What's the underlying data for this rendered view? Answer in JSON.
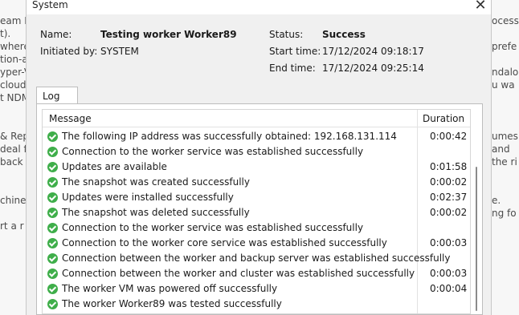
{
  "background": {
    "left_lines": [
      "eam B",
      "t).",
      "where",
      "tion-a",
      "yper-V",
      " cloud",
      "t NDM",
      "",
      "",
      "& Rep",
      "deal f",
      " back",
      "",
      "",
      "chine",
      "",
      "rt a r"
    ],
    "right_lines": [
      "ocess",
      "",
      "prefe",
      "",
      "ndalo",
      "u wa",
      "",
      "",
      "",
      "umes",
      "and",
      "the ri",
      "",
      "",
      "e.",
      "ng fo",
      ""
    ]
  },
  "dialog": {
    "title": "System",
    "close_symbol": "✕",
    "name_label": "Name:",
    "name_value": "Testing worker Worker89",
    "initiated_label": "Initiated by:",
    "initiated_value": "SYSTEM",
    "status_label": "Status:",
    "status_value": "Success",
    "start_label": "Start time:",
    "start_value": "17/12/2024 09:18:17",
    "end_label": "End time:",
    "end_value": "17/12/2024 09:25:14",
    "tab_label": "Log",
    "columns": {
      "message": "Message",
      "duration": "Duration"
    },
    "rows": [
      {
        "message": "The following IP address was successfully obtained: 192.168.131.114",
        "duration": "0:00:42"
      },
      {
        "message": "Connection to the worker service was established successfully",
        "duration": ""
      },
      {
        "message": "Updates are available",
        "duration": "0:01:58"
      },
      {
        "message": "The snapshot was created successfully",
        "duration": "0:00:02"
      },
      {
        "message": "Updates were installed successfully",
        "duration": "0:02:37"
      },
      {
        "message": "The snapshot was deleted successfully",
        "duration": "0:00:02"
      },
      {
        "message": "Connection to the worker service was established successfully",
        "duration": ""
      },
      {
        "message": "Connection to the worker core service was established successfully",
        "duration": "0:00:03"
      },
      {
        "message": "Connection between the worker and backup server was established successfully",
        "duration": ""
      },
      {
        "message": "Connection between the worker and cluster was established successfully",
        "duration": "0:00:03"
      },
      {
        "message": "The worker VM was powered off successfully",
        "duration": "0:00:04"
      },
      {
        "message": "The worker Worker89 was tested successfully",
        "duration": ""
      }
    ],
    "status_icon": "check-circle-icon",
    "colors": {
      "success": "#3fae4a"
    }
  }
}
